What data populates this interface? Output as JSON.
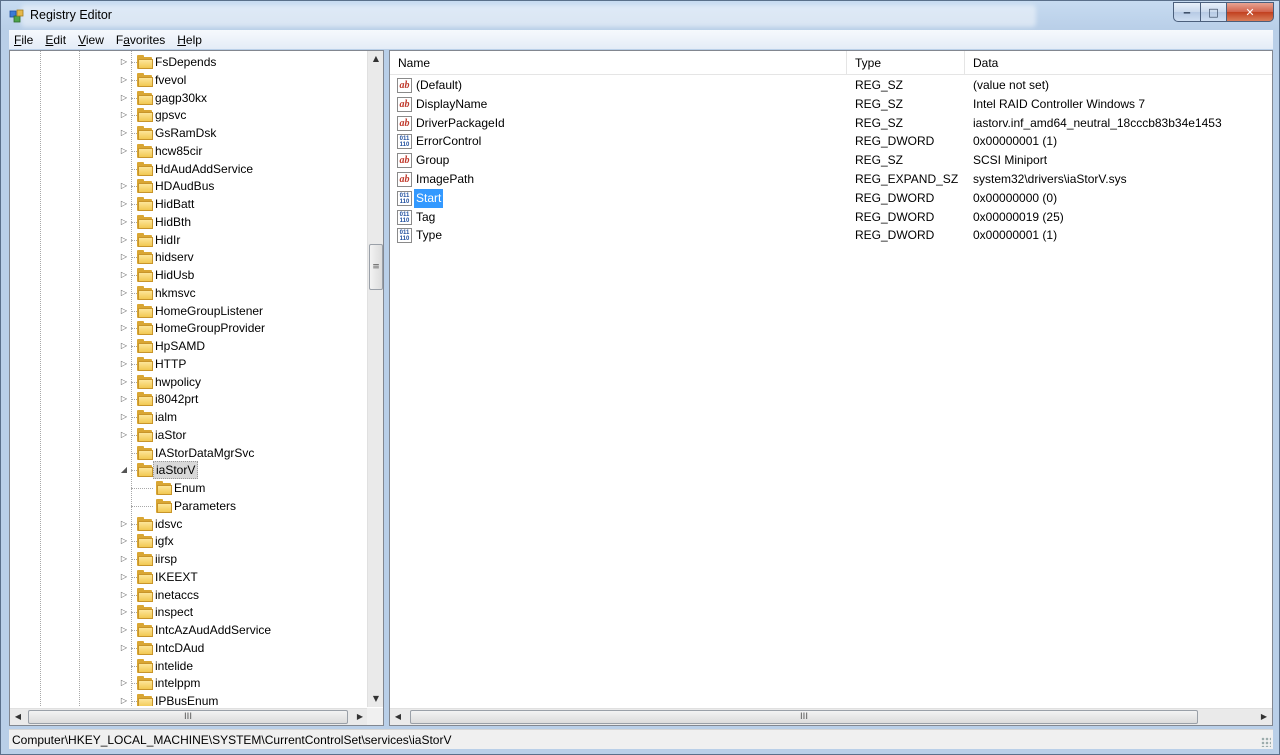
{
  "window": {
    "title": "Registry Editor",
    "caption_buttons": {
      "minimize": "‒",
      "maximize": "□",
      "close": "✕"
    }
  },
  "menu": [
    {
      "label": "File",
      "u": "F",
      "rest": "ile"
    },
    {
      "label": "Edit",
      "u": "E",
      "rest": "dit"
    },
    {
      "label": "View",
      "u": "V",
      "rest": "iew"
    },
    {
      "label": "Favorites",
      "pre": "F",
      "u": "a",
      "rest": "vorites"
    },
    {
      "label": "Help",
      "u": "H",
      "rest": "elp"
    }
  ],
  "tree": {
    "items": [
      {
        "label": "FsDepends",
        "expander": "closed"
      },
      {
        "label": "fvevol",
        "expander": "closed"
      },
      {
        "label": "gagp30kx",
        "expander": "closed"
      },
      {
        "label": "gpsvc",
        "expander": "closed"
      },
      {
        "label": "GsRamDsk",
        "expander": "closed"
      },
      {
        "label": "hcw85cir",
        "expander": "closed"
      },
      {
        "label": "HdAudAddService",
        "expander": "none"
      },
      {
        "label": "HDAudBus",
        "expander": "closed"
      },
      {
        "label": "HidBatt",
        "expander": "closed"
      },
      {
        "label": "HidBth",
        "expander": "closed"
      },
      {
        "label": "HidIr",
        "expander": "closed"
      },
      {
        "label": "hidserv",
        "expander": "closed"
      },
      {
        "label": "HidUsb",
        "expander": "closed"
      },
      {
        "label": "hkmsvc",
        "expander": "closed"
      },
      {
        "label": "HomeGroupListener",
        "expander": "closed"
      },
      {
        "label": "HomeGroupProvider",
        "expander": "closed"
      },
      {
        "label": "HpSAMD",
        "expander": "closed"
      },
      {
        "label": "HTTP",
        "expander": "closed"
      },
      {
        "label": "hwpolicy",
        "expander": "closed"
      },
      {
        "label": "i8042prt",
        "expander": "closed"
      },
      {
        "label": "ialm",
        "expander": "closed"
      },
      {
        "label": "iaStor",
        "expander": "closed"
      },
      {
        "label": "IAStorDataMgrSvc",
        "expander": "none"
      },
      {
        "label": "iaStorV",
        "expander": "open",
        "selected": true
      },
      {
        "label": "Enum",
        "expander": "none",
        "child": true
      },
      {
        "label": "Parameters",
        "expander": "none",
        "child": true
      },
      {
        "label": "idsvc",
        "expander": "closed"
      },
      {
        "label": "igfx",
        "expander": "closed"
      },
      {
        "label": "iirsp",
        "expander": "closed"
      },
      {
        "label": "IKEEXT",
        "expander": "closed"
      },
      {
        "label": "inetaccs",
        "expander": "closed"
      },
      {
        "label": "inspect",
        "expander": "closed"
      },
      {
        "label": "IntcAzAudAddService",
        "expander": "closed"
      },
      {
        "label": "IntcDAud",
        "expander": "closed"
      },
      {
        "label": "intelide",
        "expander": "none"
      },
      {
        "label": "intelppm",
        "expander": "closed"
      },
      {
        "label": "IPBusEnum",
        "expander": "closed"
      }
    ],
    "scroll_thumb_glyph": "≡",
    "hscroll_thumb_glyph": "III"
  },
  "list": {
    "columns": {
      "name": "Name",
      "type": "Type",
      "data": "Data"
    },
    "rows": [
      {
        "icon": "string-value-icon",
        "kind": "sz",
        "name": "(Default)",
        "type": "REG_SZ",
        "data": "(value not set)"
      },
      {
        "icon": "string-value-icon",
        "kind": "sz",
        "name": "DisplayName",
        "type": "REG_SZ",
        "data": "Intel RAID Controller Windows 7"
      },
      {
        "icon": "string-value-icon",
        "kind": "sz",
        "name": "DriverPackageId",
        "type": "REG_SZ",
        "data": "iastorv.inf_amd64_neutral_18cccb83b34e1453"
      },
      {
        "icon": "dword-value-icon",
        "kind": "dw",
        "name": "ErrorControl",
        "type": "REG_DWORD",
        "data": "0x00000001 (1)"
      },
      {
        "icon": "string-value-icon",
        "kind": "sz",
        "name": "Group",
        "type": "REG_SZ",
        "data": "SCSI Miniport"
      },
      {
        "icon": "string-value-icon",
        "kind": "sz",
        "name": "ImagePath",
        "type": "REG_EXPAND_SZ",
        "data": "system32\\drivers\\iaStorV.sys"
      },
      {
        "icon": "dword-value-icon",
        "kind": "dw",
        "name": "Start",
        "type": "REG_DWORD",
        "data": "0x00000000 (0)",
        "selected": true
      },
      {
        "icon": "dword-value-icon",
        "kind": "dw",
        "name": "Tag",
        "type": "REG_DWORD",
        "data": "0x00000019 (25)"
      },
      {
        "icon": "dword-value-icon",
        "kind": "dw",
        "name": "Type",
        "type": "REG_DWORD",
        "data": "0x00000001 (1)"
      }
    ],
    "icon_text": {
      "sz": "ab",
      "dw": "011\n110"
    },
    "hscroll_thumb_glyph": "III"
  },
  "status": {
    "path": "Computer\\HKEY_LOCAL_MACHINE\\SYSTEM\\CurrentControlSet\\services\\iaStorV"
  }
}
